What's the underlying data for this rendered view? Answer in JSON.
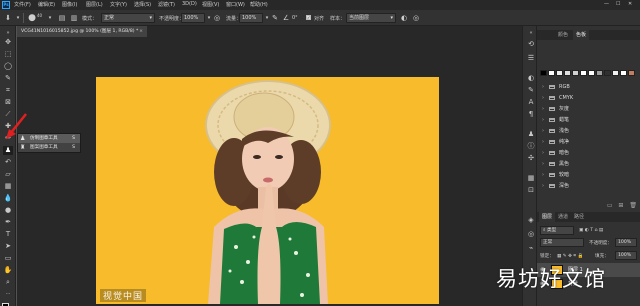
{
  "app": {
    "logo_text": "Ps"
  },
  "menu": {
    "items": [
      "文件(F)",
      "编辑(E)",
      "图像(I)",
      "图层(L)",
      "文字(Y)",
      "选择(S)",
      "滤镜(T)",
      "3D(D)",
      "视图(V)",
      "窗口(W)",
      "帮助(H)"
    ],
    "window_controls": [
      "—",
      "☐",
      "✕"
    ]
  },
  "options_bar": {
    "brush_size": "40",
    "mode_label": "模式：",
    "mode_value": "正常",
    "opacity_label": "不透明度：",
    "opacity_value": "100%",
    "flow_label": "流量：",
    "flow_value": "100%",
    "aligned_label": "对齐",
    "aligned_checked": true,
    "sample_label": "样本：",
    "sample_value": "当前图层"
  },
  "document": {
    "tab_title": "VCG41N1016015852.jpg @ 100% (图层 1, RGB/8) *",
    "tab_close": "×",
    "canvas_color": "#f7bb2b",
    "watermark_bottom_left": "视觉中国"
  },
  "tool_flyout": {
    "items": [
      {
        "label": "仿制图章工具",
        "key": "S",
        "icon": "clone-stamp-icon"
      },
      {
        "label": "图案图章工具",
        "key": "S",
        "icon": "pattern-stamp-icon"
      }
    ]
  },
  "panels": {
    "top_tabs": [
      "颜色",
      "色板"
    ],
    "channels_tabs": [
      "图层",
      "通道",
      "路径"
    ],
    "swatch_colors": [
      "#000000",
      "#ffffff",
      "#f0f0f0",
      "#e0e0e0",
      "#d0d0d0",
      "#ffffff",
      "#ffffff",
      "#a0a0a0",
      "#303030",
      "#f0f0f0",
      "#ffffff",
      "#c08060"
    ],
    "channel_groups": [
      "RGB",
      "CMYK",
      "灰度",
      "蜡笔",
      "浅色",
      "纯净",
      "暗色",
      "黑色",
      "较暗",
      "深色"
    ],
    "layers_tabs": [
      "图层",
      "通道",
      "路径"
    ],
    "kind_label": "类型",
    "blend_mode": "正常",
    "opacity_label": "不透明度：",
    "opacity_value": "100%",
    "lock_label": "锁定：",
    "fill_label": "填充：",
    "fill_value": "100%",
    "layers": [
      {
        "name": "图层 1",
        "selected": true
      },
      {
        "name": "背景",
        "selected": false
      }
    ]
  },
  "watermark_right": "易坊好文馆",
  "colors": {
    "accent": "#31a8ff",
    "canvas": "#f7bb2b",
    "highlight_arrow": "#e02020"
  }
}
